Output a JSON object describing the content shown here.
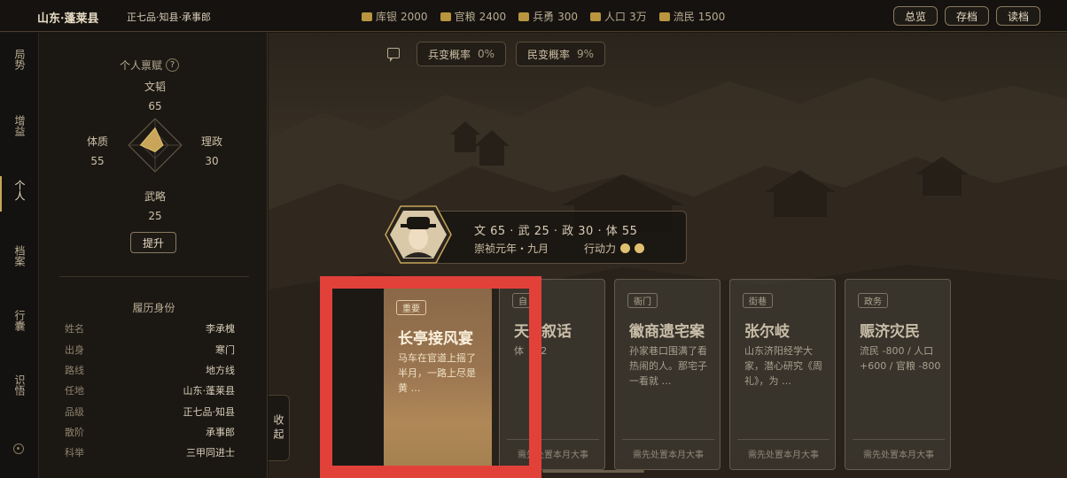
{
  "header": {
    "region": "山东·蓬莱县",
    "rank": "正七品·知县·承事郎",
    "stats": [
      {
        "icon": "silver-icon",
        "label": "库银",
        "value": "2000"
      },
      {
        "icon": "grain-icon",
        "label": "官粮",
        "value": "2400"
      },
      {
        "icon": "soldier-icon",
        "label": "兵勇",
        "value": "300"
      },
      {
        "icon": "population-icon",
        "label": "人口",
        "value": "3万"
      },
      {
        "icon": "refugee-icon",
        "label": "流民",
        "value": "1500"
      }
    ],
    "buttons": [
      "总览",
      "存档",
      "读档"
    ]
  },
  "nav": [
    {
      "label": "局势"
    },
    {
      "label": "增益"
    },
    {
      "label": "个人",
      "active": true
    },
    {
      "label": "档案"
    },
    {
      "label": "行囊"
    },
    {
      "label": "识悟"
    }
  ],
  "profile": {
    "talent_title": "个人禀赋",
    "help": "?",
    "attrs": {
      "wen": {
        "label": "文韬",
        "value": "65"
      },
      "li": {
        "label": "理政",
        "value": "30"
      },
      "wu": {
        "label": "武略",
        "value": "25"
      },
      "ti": {
        "label": "体质",
        "value": "55"
      }
    },
    "boost_label": "提升",
    "resume_title": "履历身份",
    "rows": [
      {
        "k": "姓名",
        "v": "李承槐"
      },
      {
        "k": "出身",
        "v": "寒门"
      },
      {
        "k": "路线",
        "v": "地方线"
      },
      {
        "k": "任地",
        "v": "山东·蓬莱县"
      },
      {
        "k": "品级",
        "v": "正七品·知县"
      },
      {
        "k": "散阶",
        "v": "承事郎"
      },
      {
        "k": "科举",
        "v": "三甲同进士"
      }
    ]
  },
  "collapse_label": "收起",
  "scene": {
    "pills": [
      {
        "label": "兵变概率",
        "value": "0%"
      },
      {
        "label": "民变概率",
        "value": "9%"
      }
    ],
    "character": {
      "stats": "文 65 · 武 25 · 政 30 · 体 55",
      "date": "崇祯元年・九月",
      "action_label": "行动力",
      "action_points": 2
    },
    "cards": [
      {
        "tag": "重要",
        "title": "长亭接风宴",
        "desc": "马车在官道上摇了半月，一路上尽是黄 …",
        "foot": ""
      },
      {
        "tag": "自",
        "title": "天",
        "title2": "叙话",
        "desc": "体",
        "desc2": "+2",
        "foot": "需先处置本月大事"
      },
      {
        "tag": "衙门",
        "title": "徽商遗宅案",
        "desc": "孙家巷口围满了看热闹的人。那宅子一看就 …",
        "foot": "需先处置本月大事"
      },
      {
        "tag": "街巷",
        "title": "张尔岐",
        "desc": "山东济阳经学大家，潜心研究《周礼》，为 …",
        "foot": "需先处置本月大事"
      },
      {
        "tag": "政务",
        "title": "赈济灾民",
        "desc": "流民 -800 / 人口 +600 / 官粮 -800",
        "foot": "需先处置本月大事"
      }
    ]
  },
  "colors": {
    "accent_gold": "#c7a55a",
    "highlight_red": "#e2413a",
    "action_dot": "#e0c070"
  }
}
